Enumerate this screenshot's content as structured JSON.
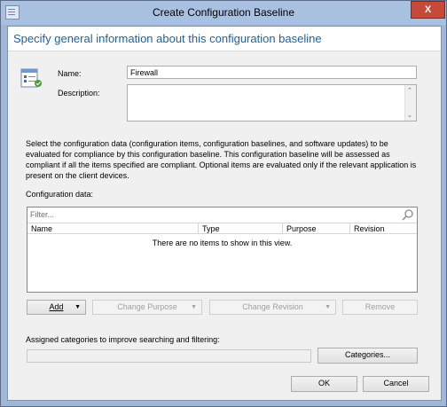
{
  "window": {
    "title": "Create Configuration Baseline",
    "close_glyph": "X"
  },
  "header": {
    "text": "Specify general information about this configuration baseline"
  },
  "general": {
    "name_label": "Name:",
    "name_value": "Firewall",
    "description_label": "Description:",
    "description_value": "",
    "baseline_icon": "configuration-baseline-icon"
  },
  "instructions": "Select the configuration data (configuration items, configuration baselines, and software updates) to be evaluated for compliance by this configuration baseline. This configuration baseline will be assessed as compliant if all the items specified are compliant. Optional items are evaluated only if the relevant application is present on  the client devices.",
  "configuration_data": {
    "label": "Configuration data:",
    "filter_placeholder": "Filter...",
    "columns": [
      "Name",
      "Type",
      "Purpose",
      "Revision"
    ],
    "empty_message": "There are no items to show in this view."
  },
  "actions": {
    "add": "Add",
    "change_purpose": "Change Purpose",
    "change_revision": "Change Revision",
    "remove": "Remove"
  },
  "categories": {
    "label": "Assigned categories to improve searching and filtering:",
    "value": "",
    "button": "Categories..."
  },
  "footer": {
    "ok": "OK",
    "cancel": "Cancel"
  },
  "colors": {
    "header_text": "#1f5fa8",
    "close_button": "#c7493a",
    "title_bar": "#a9c1e0"
  }
}
